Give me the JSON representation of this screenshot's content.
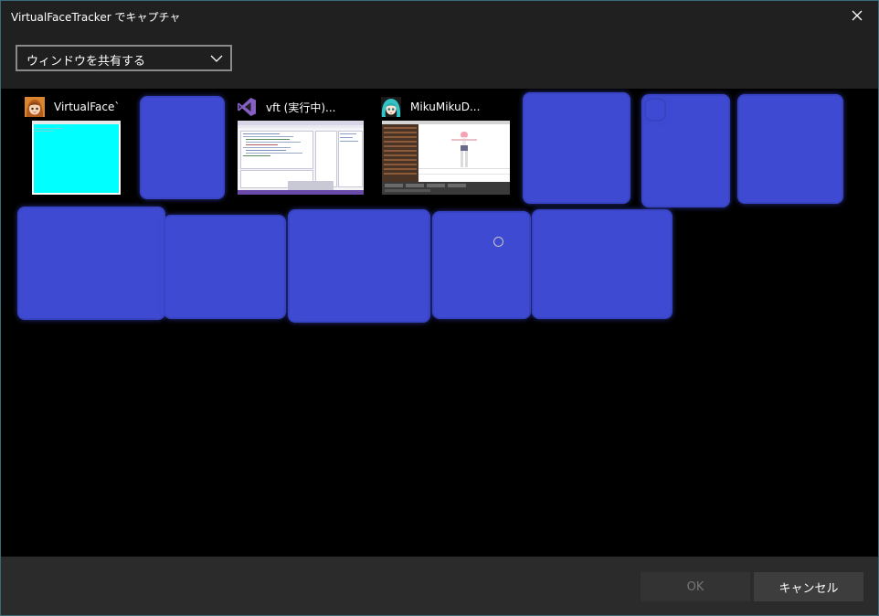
{
  "window": {
    "title": "VirtualFaceTracker でキャプチャ",
    "close_icon": "close-icon"
  },
  "toolbar": {
    "dropdown_value": "ウィンドウを共有する",
    "dropdown_icon": "chevron-down-icon"
  },
  "windows": [
    {
      "label": "VirtualFace`",
      "icon": "anime-avatar-icon",
      "thumb": "cyan-window"
    },
    {
      "label": "vft (実行中)...",
      "icon": "visual-studio-icon",
      "thumb": "ide-window"
    },
    {
      "label": "MikuMikuD...",
      "icon": "miku-avatar-icon",
      "thumb": "mmd-window"
    }
  ],
  "redacted_count": 10,
  "footer": {
    "ok_label": "OK",
    "cancel_label": "キャンセル"
  },
  "colors": {
    "background": "#202020",
    "grid_background": "#000000",
    "redaction": "#3e4ad2",
    "thumb_cyan": "#00ffff",
    "vs_purple": "#865fc5"
  }
}
